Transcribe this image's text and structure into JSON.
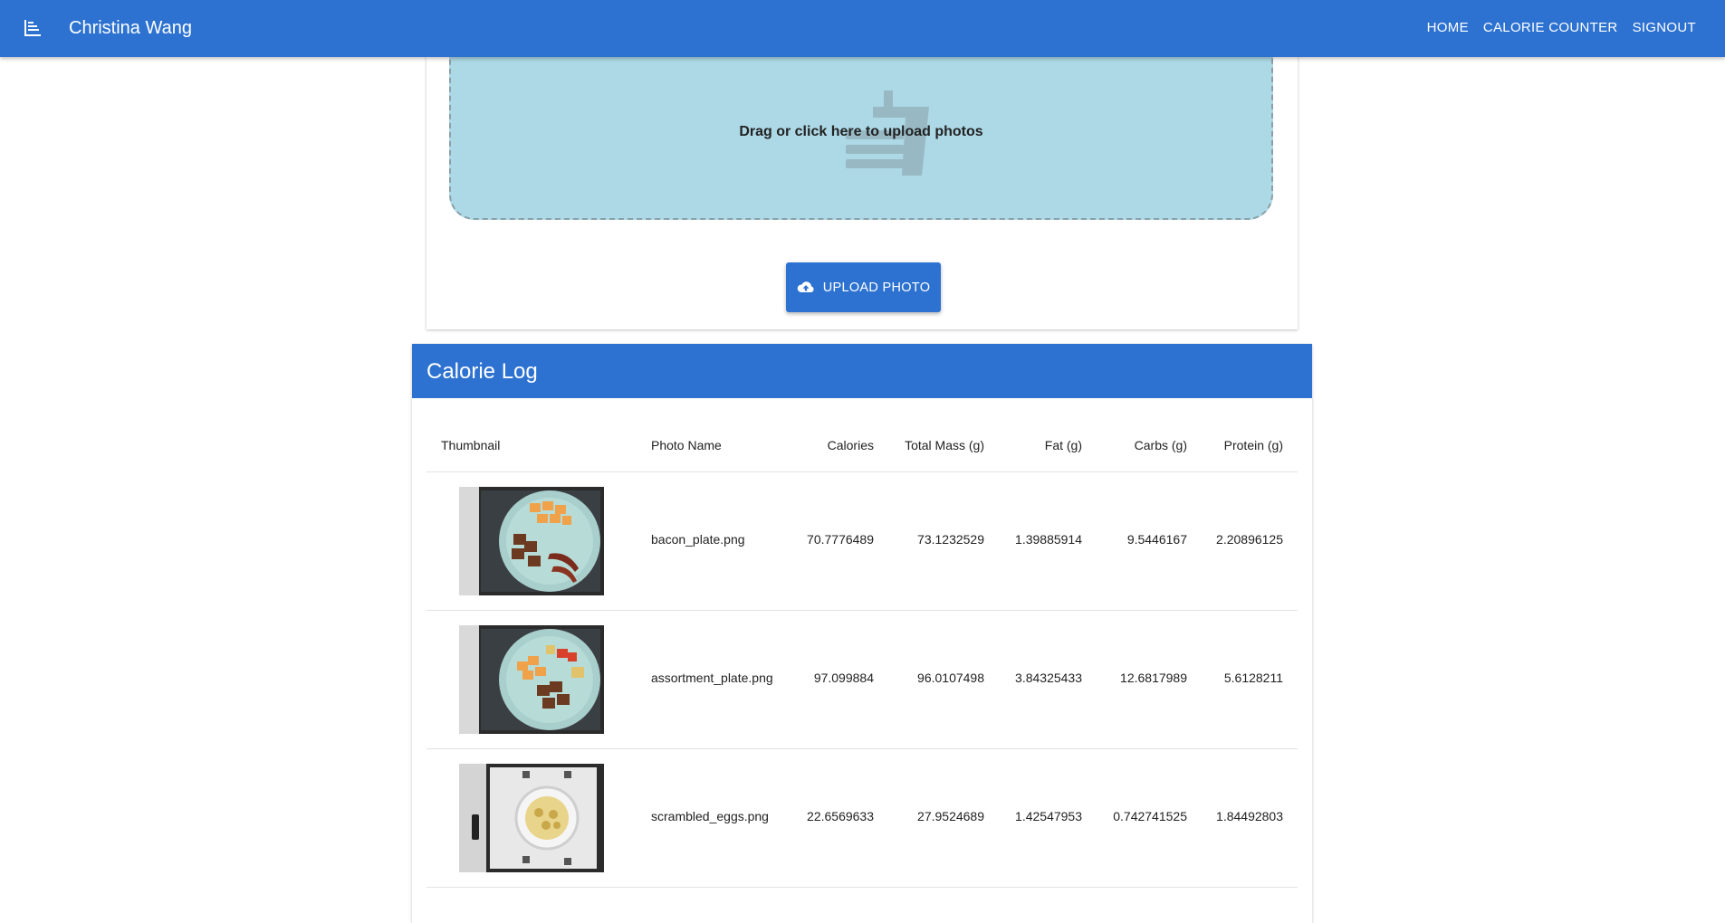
{
  "appbar": {
    "title": "Christina Wang",
    "nav": [
      "HOME",
      "CALORIE COUNTER",
      "SIGNOUT"
    ],
    "color": "#2d72d0"
  },
  "upload": {
    "drop_text": "Drag or click here to upload photos",
    "button_label": "UPLOAD PHOTO",
    "dropzone_color": "#add8e6"
  },
  "log": {
    "title": "Calorie Log",
    "columns": [
      "Thumbnail",
      "Photo Name",
      "Calories",
      "Total Mass (g)",
      "Fat (g)",
      "Carbs (g)",
      "Protein (g)"
    ],
    "rows": [
      {
        "name": "bacon_plate.png",
        "calories": "70.7776489",
        "mass": "73.1232529",
        "fat": "1.39885914",
        "carbs": "9.5446167",
        "protein": "2.20896125",
        "thumb": "plate-melon-bacon"
      },
      {
        "name": "assortment_plate.png",
        "calories": "97.099884",
        "mass": "96.0107498",
        "fat": "3.84325433",
        "carbs": "12.6817989",
        "protein": "5.6128211",
        "thumb": "plate-assortment"
      },
      {
        "name": "scrambled_eggs.png",
        "calories": "22.6569633",
        "mass": "27.9524689",
        "fat": "1.42547953",
        "carbs": "0.742741525",
        "protein": "1.84492803",
        "thumb": "bowl-eggs"
      }
    ]
  }
}
